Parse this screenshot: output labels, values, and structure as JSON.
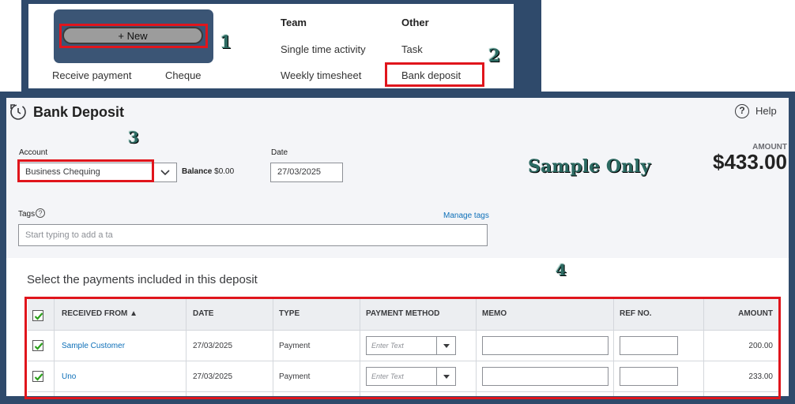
{
  "menu": {
    "new_button_label": "+ New",
    "team_heading": "Team",
    "other_heading": "Other",
    "items": {
      "receive_payment": "Receive payment",
      "cheque": "Cheque",
      "single_time_activity": "Single time activity",
      "weekly_timesheet": "Weekly timesheet",
      "task": "Task",
      "bank_deposit": "Bank deposit"
    }
  },
  "annotations": {
    "n1": "1",
    "n2": "2",
    "n3": "3",
    "n4": "4",
    "sample_note": "Sample Only"
  },
  "deposit": {
    "title": "Bank Deposit",
    "help_label": "Help",
    "account_label": "Account",
    "account_value": "Business Chequing",
    "balance_label": "Balance",
    "balance_value": "$0.00",
    "date_label": "Date",
    "date_value": "27/03/2025",
    "amount_label": "AMOUNT",
    "amount_value": "$433.00",
    "tags_label": "Tags",
    "manage_tags_label": "Manage tags",
    "tags_placeholder": "Start typing to add a ta",
    "select_caption": "Select the payments included in this deposit"
  },
  "table": {
    "headers": {
      "received_from": "RECEIVED FROM ▲",
      "date": "DATE",
      "type": "TYPE",
      "payment_method": "PAYMENT METHOD",
      "memo": "MEMO",
      "ref_no": "REF NO.",
      "amount": "AMOUNT"
    },
    "payment_method_placeholder": "Enter Text",
    "rows": [
      {
        "received_from": "Sample Customer",
        "date": "27/03/2025",
        "type": "Payment",
        "amount": "200.00",
        "checked": true
      },
      {
        "received_from": "Uno",
        "date": "27/03/2025",
        "type": "Payment",
        "amount": "233.00",
        "checked": true
      }
    ]
  },
  "colors": {
    "frame": "#2f4a6b",
    "annotation_red": "#e0151c",
    "annotation_teal": "#2c6a62",
    "link": "#0d6fb8",
    "check_green": "#2ca01c"
  }
}
